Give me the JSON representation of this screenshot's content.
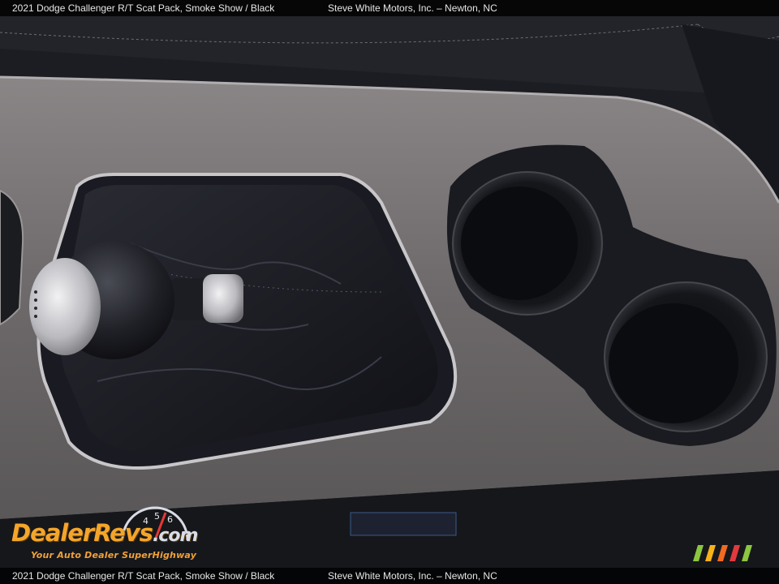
{
  "caption": {
    "vehicle": "2021 Dodge Challenger R/T Scat Pack,  Smoke Show / Black",
    "dealer": "Steve White Motors, Inc.  –  Newton, NC"
  },
  "watermark": {
    "brand": "DealerRevs",
    "domain": ".com",
    "tagline": "Your Auto Dealer SuperHighway",
    "gauge_digits": [
      "4",
      "5",
      "6"
    ]
  },
  "photo": {
    "subject": "center-console",
    "colors": {
      "console_trim": "#6f6b6c",
      "leather": "#1b1c22",
      "cupholder": "#0e0f12",
      "knob": "#1e1f24",
      "chrome": "#c8c8cc"
    }
  },
  "stripe_colors": [
    "#8cc63f",
    "#f7b21a",
    "#f26a21",
    "#e03a3e",
    "#8cc63f"
  ]
}
